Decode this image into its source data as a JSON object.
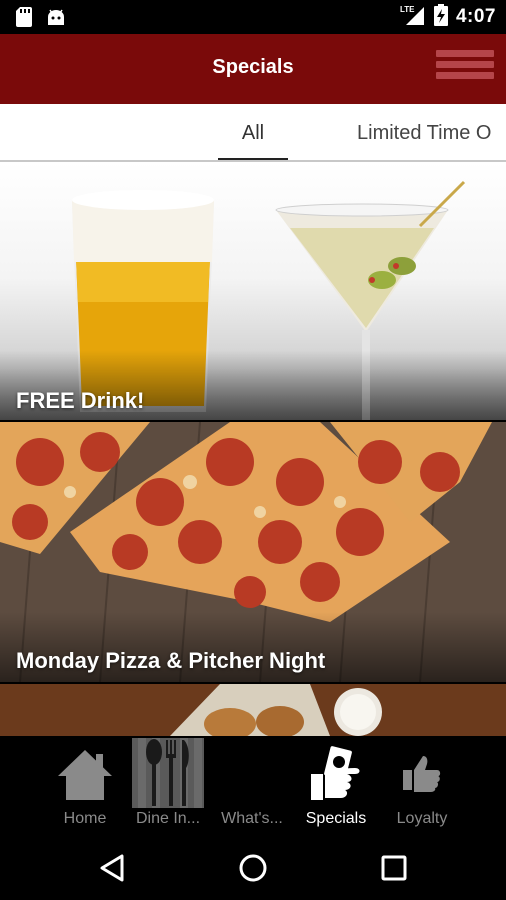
{
  "status_bar": {
    "time": "4:07",
    "network": "LTE"
  },
  "app_bar": {
    "title": "Specials",
    "menu_icon": "hamburger-menu-icon"
  },
  "tabs": [
    {
      "label": "All",
      "selected": true
    },
    {
      "label": "Limited Time O",
      "selected": false
    }
  ],
  "specials": [
    {
      "title": "FREE Drink!",
      "image": "beer-and-martini-photo"
    },
    {
      "title": "Monday Pizza & Pitcher Night",
      "image": "pepperoni-pizza-photo"
    },
    {
      "title": "",
      "image": "wings-photo"
    }
  ],
  "bottom_nav": [
    {
      "label": "Home",
      "icon": "home-icon"
    },
    {
      "label": "Dine In...",
      "icon": "utensils-icon"
    },
    {
      "label": "What's...",
      "icon": "whats-new-icon"
    },
    {
      "label": "Specials",
      "icon": "specials-ticket-icon",
      "active": true
    },
    {
      "label": "Loyalty",
      "icon": "thumbs-up-icon"
    }
  ],
  "colors": {
    "app_bar": "#7a0a0a",
    "active_tab_underline": "#222222",
    "nav_inactive": "#8a8a8a",
    "nav_active": "#ffffff"
  }
}
